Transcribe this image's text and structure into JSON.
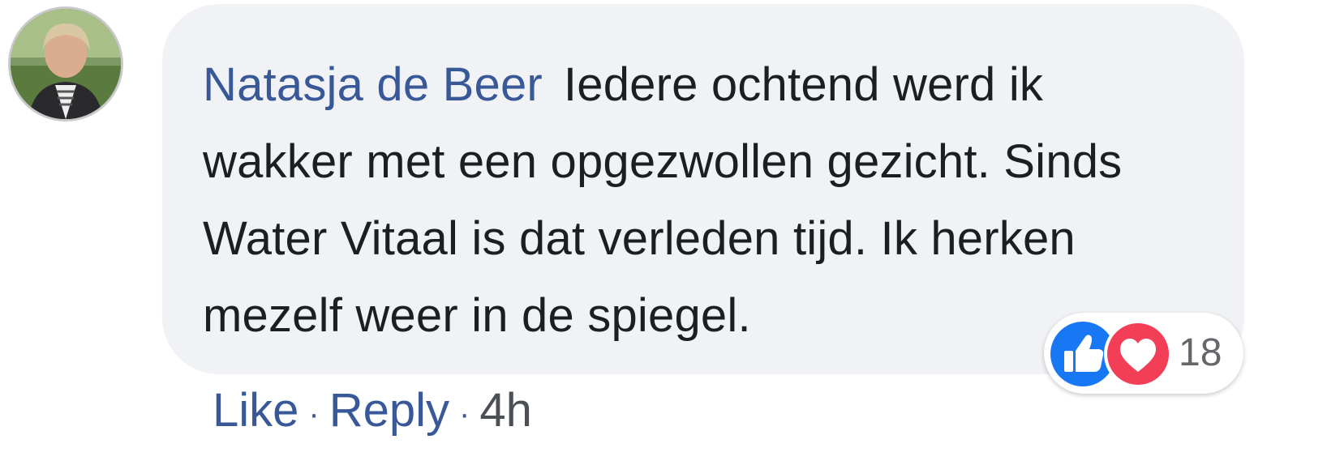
{
  "comment": {
    "author": "Natasja de Beer",
    "text": "Iedere ochtend werd ik wakker met een opgezwollen gezicht. Sinds Water Vitaal is dat verleden tijd. Ik herken mezelf weer in de spiegel.",
    "reactions": {
      "icons": [
        "like-icon",
        "love-icon"
      ],
      "count": "18"
    },
    "actions": {
      "like_label": "Like",
      "separator": "·",
      "reply_label": "Reply",
      "time": "4h"
    }
  },
  "colors": {
    "author": "#385898",
    "bubble": "#f0f2f5",
    "like": "#1877f2",
    "love": "#f33e58"
  }
}
